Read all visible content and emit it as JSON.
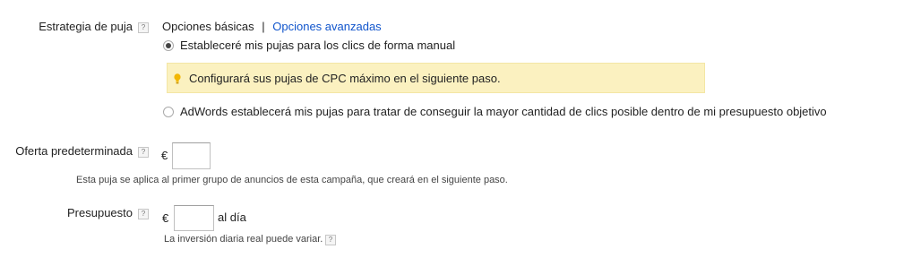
{
  "bid_strategy": {
    "label": "Estrategia de puja",
    "help": "?",
    "options_basic": "Opciones básicas",
    "separator": "|",
    "options_advanced": "Opciones avanzadas",
    "manual_option": "Estableceré mis pujas para los clics de forma manual",
    "manual_selected": true,
    "notice": "Configurará sus pujas de CPC máximo en el siguiente paso.",
    "auto_option": "AdWords establecerá mis pujas para tratar de conseguir la mayor cantidad de clics posible dentro de mi presupuesto objetivo",
    "auto_selected": false
  },
  "default_bid": {
    "label": "Oferta predeterminada",
    "help": "?",
    "currency": "€",
    "value": "",
    "hint": "Esta puja se aplica al primer grupo de anuncios de esta campaña, que creará en el siguiente paso."
  },
  "budget": {
    "label": "Presupuesto",
    "help": "?",
    "currency": "€",
    "value": "",
    "suffix": "al día",
    "hint": "La inversión diaria real puede variar.",
    "hint_help": "?"
  },
  "colors": {
    "link": "#1155cc",
    "notice_bg": "#fbf1c0",
    "bulb": "#f2b705"
  },
  "icons": {
    "help": "question-mark-box",
    "notice": "lightbulb"
  }
}
